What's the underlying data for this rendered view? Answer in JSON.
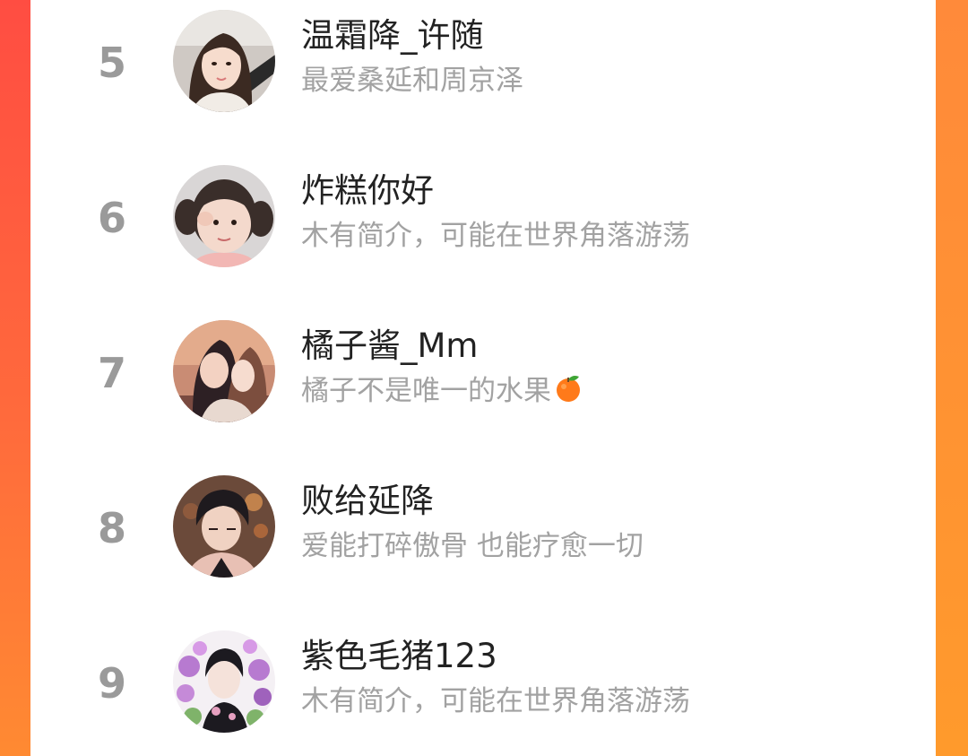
{
  "ranking_list": {
    "users": [
      {
        "rank": "5",
        "name": "温霜降_许随",
        "bio": "最爱桑延和周京泽",
        "avatar_icon": "avatar-girl-selfie-icon"
      },
      {
        "rank": "6",
        "name": "炸糕你好",
        "bio": "木有简介，可能在世界角落游荡",
        "avatar_icon": "avatar-child-icon"
      },
      {
        "rank": "7",
        "name": "橘子酱_Mm",
        "bio": "橘子不是唯一的水果",
        "bio_emoji": "tangerine-emoji",
        "avatar_icon": "avatar-anime-couple-icon"
      },
      {
        "rank": "8",
        "name": "败给延降",
        "bio": "爱能打碎傲骨 也能疗愈一切",
        "avatar_icon": "avatar-anime-boy-icon"
      },
      {
        "rank": "9",
        "name": "紫色毛猪123",
        "bio": "木有简介，可能在世界角落游荡",
        "avatar_icon": "avatar-anime-boy-flowers-icon"
      }
    ]
  },
  "colors": {
    "background_red": "#ff4d42",
    "background_orange": "#ff8a32",
    "panel": "#ffffff",
    "rank_text": "#9a9a9a",
    "name_text": "#222222",
    "bio_text": "#a2a2a2"
  }
}
